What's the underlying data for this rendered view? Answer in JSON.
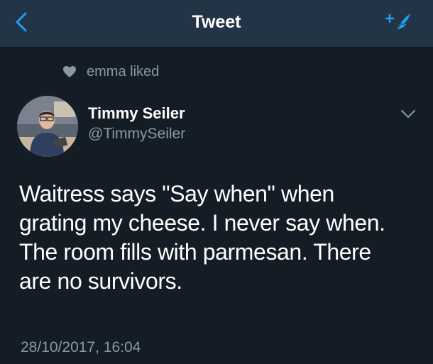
{
  "nav": {
    "title": "Tweet",
    "back_icon": "chevron-left-icon",
    "compose_icon": "compose-tweet-icon",
    "accent_color": "#1da1f2"
  },
  "social_context": {
    "icon": "heart-icon",
    "text": "emma liked"
  },
  "tweet": {
    "author_name": "Timmy Seiler",
    "author_handle": "@TimmySeiler",
    "text_lines": [
      "Waitress says \"Say when\" when",
      "grating my cheese. I never say when.",
      "The room fills with parmesan. There",
      "are no survivors."
    ],
    "timestamp": "28/10/2017, 16:04",
    "menu_icon": "chevron-down-icon"
  },
  "colors": {
    "background": "#141d26",
    "navbar": "#243447",
    "secondary_text": "#8899a6",
    "primary_text": "#ffffff"
  }
}
